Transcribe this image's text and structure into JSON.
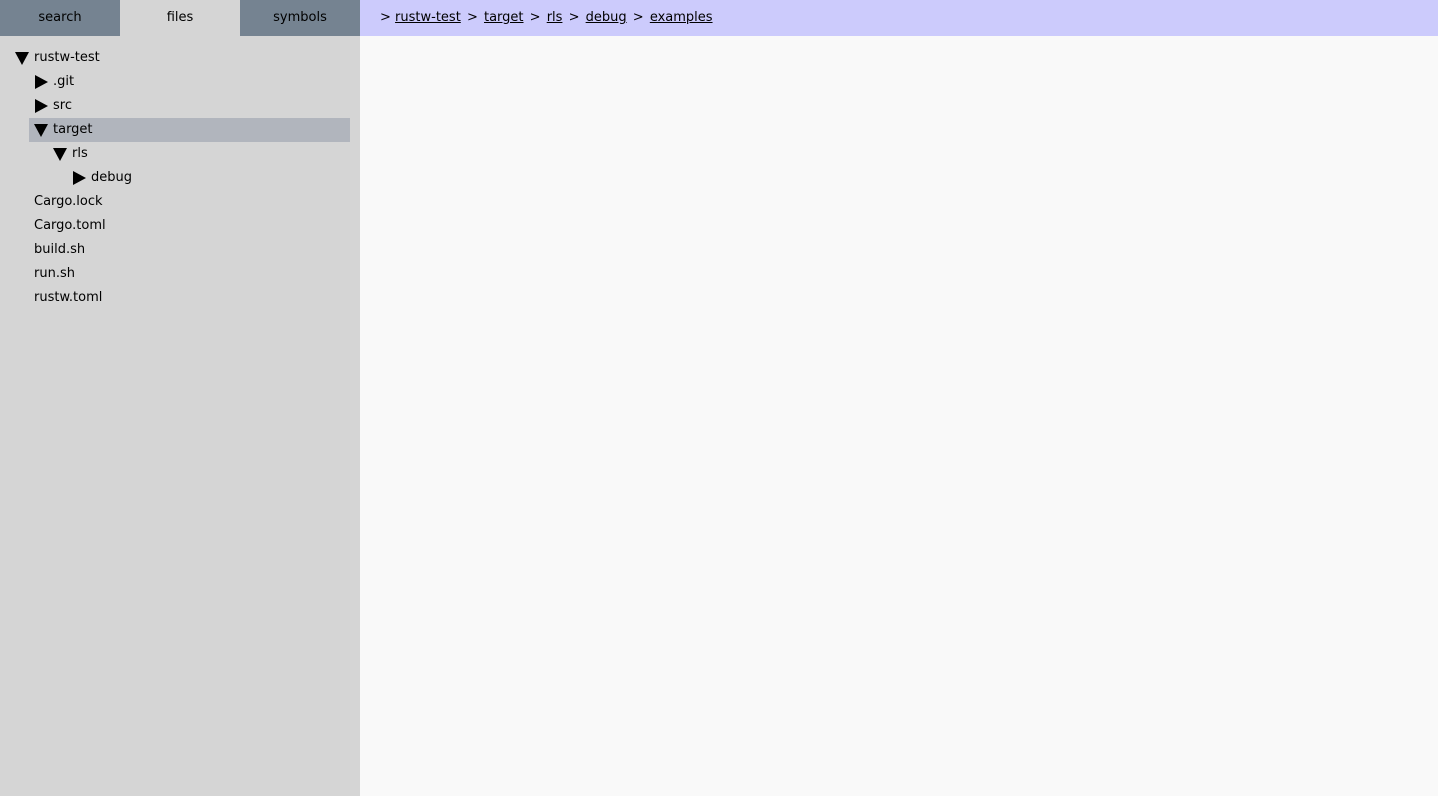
{
  "tabs": [
    {
      "label": "search",
      "active": false
    },
    {
      "label": "files",
      "active": true
    },
    {
      "label": "symbols",
      "active": false
    }
  ],
  "tree": [
    {
      "label": "rustw-test",
      "depth": 0,
      "kind": "dir",
      "expanded": true,
      "selected": false
    },
    {
      "label": ".git",
      "depth": 1,
      "kind": "dir",
      "expanded": false,
      "selected": false
    },
    {
      "label": "src",
      "depth": 1,
      "kind": "dir",
      "expanded": false,
      "selected": false
    },
    {
      "label": "target",
      "depth": 1,
      "kind": "dir",
      "expanded": true,
      "selected": true
    },
    {
      "label": "rls",
      "depth": 2,
      "kind": "dir",
      "expanded": true,
      "selected": false
    },
    {
      "label": "debug",
      "depth": 3,
      "kind": "dir",
      "expanded": false,
      "selected": false
    },
    {
      "label": "Cargo.lock",
      "depth": 0,
      "kind": "file",
      "selected": false
    },
    {
      "label": "Cargo.toml",
      "depth": 0,
      "kind": "file",
      "selected": false
    },
    {
      "label": "build.sh",
      "depth": 0,
      "kind": "file",
      "selected": false
    },
    {
      "label": "run.sh",
      "depth": 0,
      "kind": "file",
      "selected": false
    },
    {
      "label": "rustw.toml",
      "depth": 0,
      "kind": "file",
      "selected": false
    }
  ],
  "breadcrumb": {
    "prefix": ">",
    "separator": ">",
    "items": [
      "rustw-test",
      "target",
      "rls",
      "debug",
      "examples"
    ]
  },
  "colors": {
    "sidebar_bg": "#d5d5d5",
    "tab_bg": "#758391",
    "selected_row": "#b1b5bd",
    "topbar_bg": "#cccbfc",
    "main_bg": "#f9f9f9"
  }
}
